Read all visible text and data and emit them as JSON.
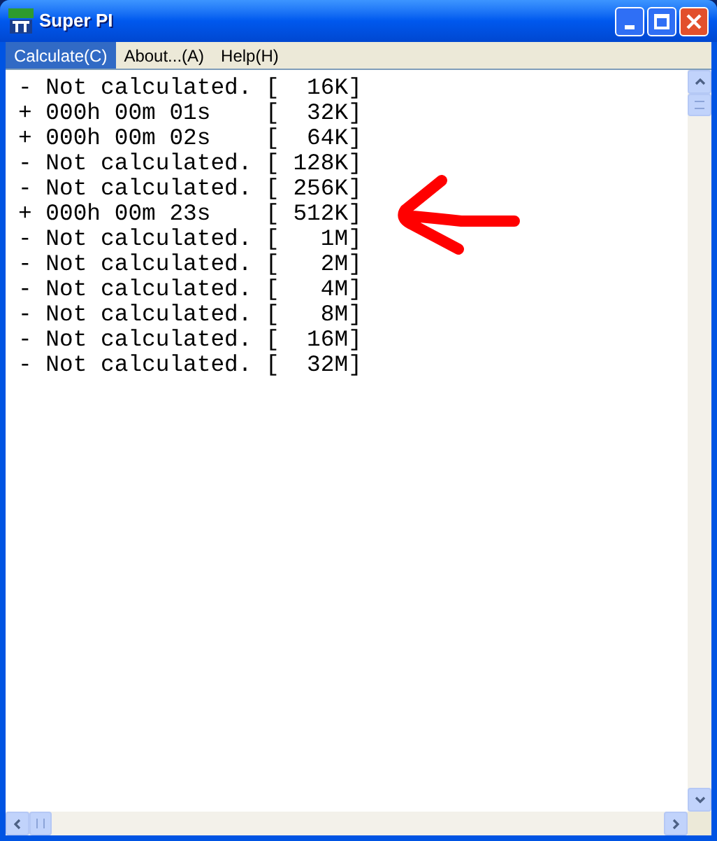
{
  "window": {
    "title": "Super PI"
  },
  "menu": [
    {
      "label": "Calculate(C)",
      "selected": true
    },
    {
      "label": "About...(A)",
      "selected": false
    },
    {
      "label": "Help(H)",
      "selected": false
    }
  ],
  "results": [
    "- Not calculated. [  16K]",
    "+ 000h 00m 01s    [  32K]",
    "+ 000h 00m 02s    [  64K]",
    "- Not calculated. [ 128K]",
    "- Not calculated. [ 256K]",
    "+ 000h 00m 23s    [ 512K]",
    "- Not calculated. [   1M]",
    "- Not calculated. [   2M]",
    "- Not calculated. [   4M]",
    "- Not calculated. [   8M]",
    "- Not calculated. [  16M]",
    "- Not calculated. [  32M]"
  ]
}
